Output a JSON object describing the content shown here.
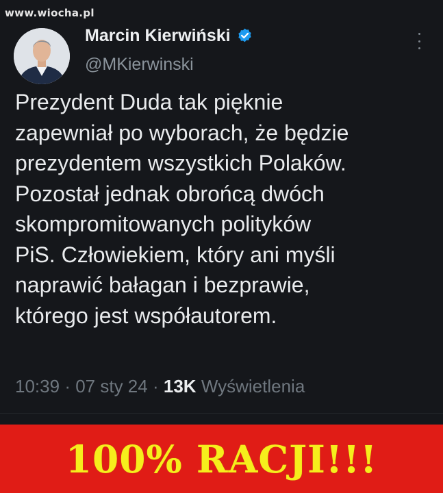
{
  "watermark": "www.wiocha.pl",
  "author": {
    "display_name": "Marcin Kierwiński",
    "handle": "@MKierwinski",
    "verified": true
  },
  "icons": {
    "verified": "verified-badge-icon",
    "more": "more-options-icon"
  },
  "tweet": {
    "lines": [
      "Prezydent Duda tak pięknie",
      "zapewniał po wyborach, że będzie",
      "prezydentem wszystkich Polaków.",
      "Pozostał jednak obrońcą dwóch",
      "skompromitowanych polityków",
      "PiS. Człowiekiem, który ani myśli",
      "naprawić bałagan i bezprawie,",
      "którego jest współautorem."
    ]
  },
  "meta": {
    "time": "10:39",
    "separator": "·",
    "date": "07 sty 24",
    "views_count": "13K",
    "views_label": "Wyświetlenia"
  },
  "banner": {
    "text": "100% RACJI!!!"
  },
  "colors": {
    "background": "#15171b",
    "verified_blue": "#1d9bf0",
    "banner_red": "#e01c16",
    "banner_yellow": "#f6ee1c"
  }
}
